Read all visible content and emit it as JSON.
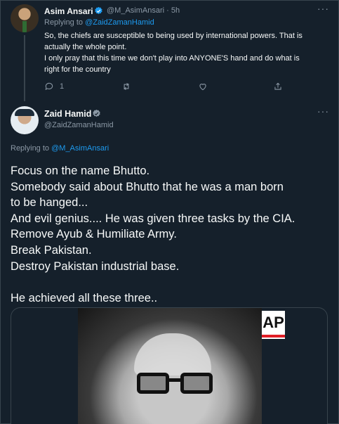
{
  "tweet1": {
    "name": "Asim Ansari",
    "handle_time": "@M_AsimAnsari · 5h",
    "replying_prefix": "Replying to",
    "replying_to": "@ZaidZamanHamid",
    "lines": [
      "So, the chiefs are susceptible to being used by international powers. That is",
      "actually the whole point.",
      "I only pray that this time we don't play into ANYONE'S hand and do what is",
      "right for the country"
    ],
    "actions": {
      "reply_count": "1",
      "retweet_count": "",
      "like_count": ""
    }
  },
  "tweet2": {
    "name": "Zaid Hamid",
    "handle": "@ZaidZamanHamid",
    "replying_prefix": "Replying to",
    "replying_to": "@M_AsimAnsari",
    "lines": [
      "Focus on the name Bhutto.",
      "Somebody said about Bhutto that he was a man born",
      "to be hanged...",
      "And evil genius.... He was given three tasks by the CIA.",
      "Remove Ayub & Humiliate Army.",
      "Break Pakistan.",
      "Destroy Pakistan industrial base.",
      "",
      "He achieved all these three.."
    ],
    "media_badge": "AP"
  },
  "colors": {
    "background": "#15202b",
    "text": "#f7f9f9",
    "muted": "#8b98a5",
    "accent": "#1d9bf0",
    "border": "#38444d"
  },
  "icons": [
    "verified-badge-icon",
    "more-icon",
    "reply-icon",
    "retweet-icon",
    "like-icon",
    "share-icon"
  ]
}
